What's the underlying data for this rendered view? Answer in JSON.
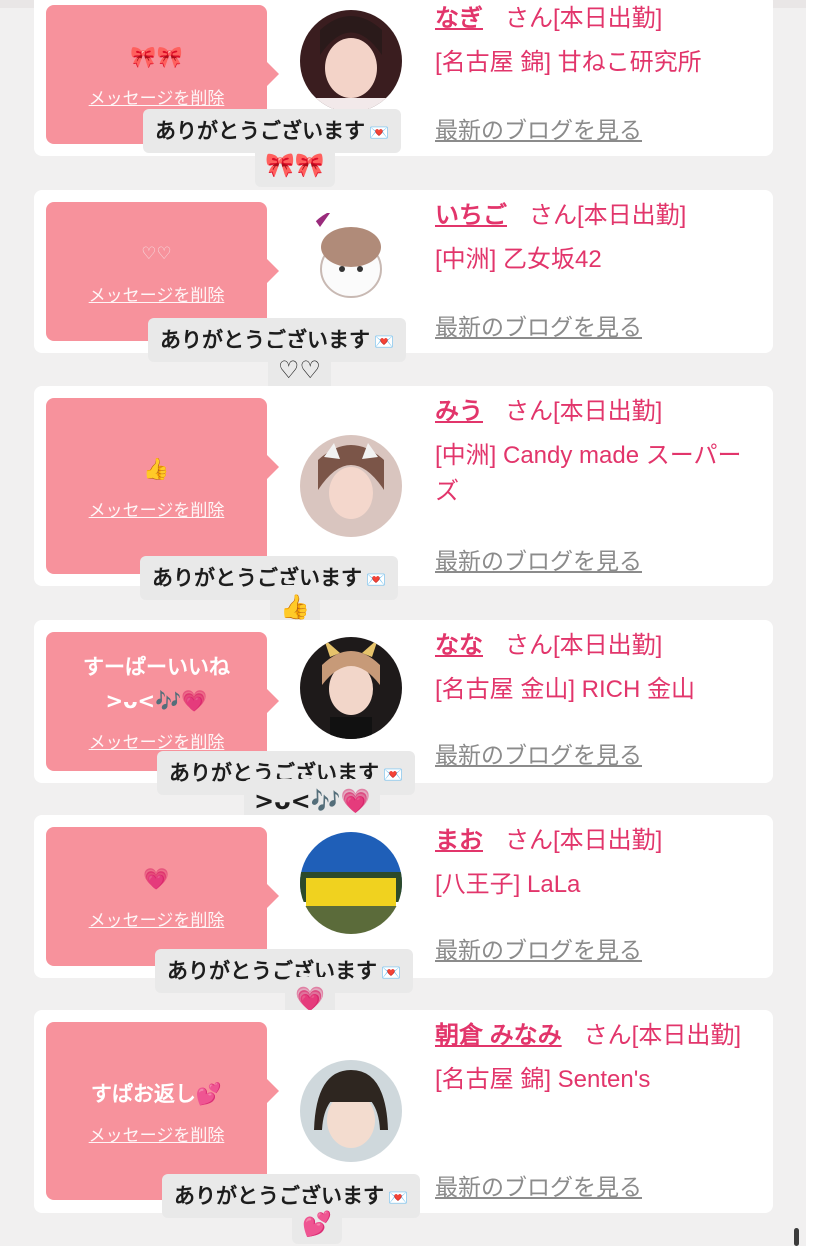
{
  "ui": {
    "delete_label": "メッセージを削除",
    "honorific": "さん[本日出勤]",
    "blog_label": "最新のブログを見る",
    "toast_text": "ありがとうございます",
    "toast_icon": "💌"
  },
  "cards": [
    {
      "message": "🎀🎀",
      "name": "なぎ",
      "shop": "[名古屋 錦] 甘ねこ研究所",
      "reply": "🎀🎀"
    },
    {
      "message": "♡♡",
      "name": "いちご",
      "shop": "[中洲] 乙女坂42",
      "reply": "♡♡"
    },
    {
      "message": "👍",
      "name": "みう",
      "shop": "[中洲] Candy made スーパーズ",
      "reply": "👍"
    },
    {
      "message": "すーぱーいいね\n>ᴗ<🎶💗",
      "name": "なな",
      "shop": "[名古屋 金山] RICH 金山",
      "reply": ">ᴗ<🎶💗"
    },
    {
      "message": "💗",
      "name": "まお",
      "shop": "[八王子] LaLa",
      "reply": "💗"
    },
    {
      "message": "すぱお返し💕",
      "name": "朝倉 みなみ",
      "shop": "[名古屋 錦] Senten's",
      "reply": "💕"
    }
  ],
  "colors": {
    "accent": "#e2356b",
    "bubble": "#f7929c",
    "link_gray": "#8b8b8b"
  }
}
